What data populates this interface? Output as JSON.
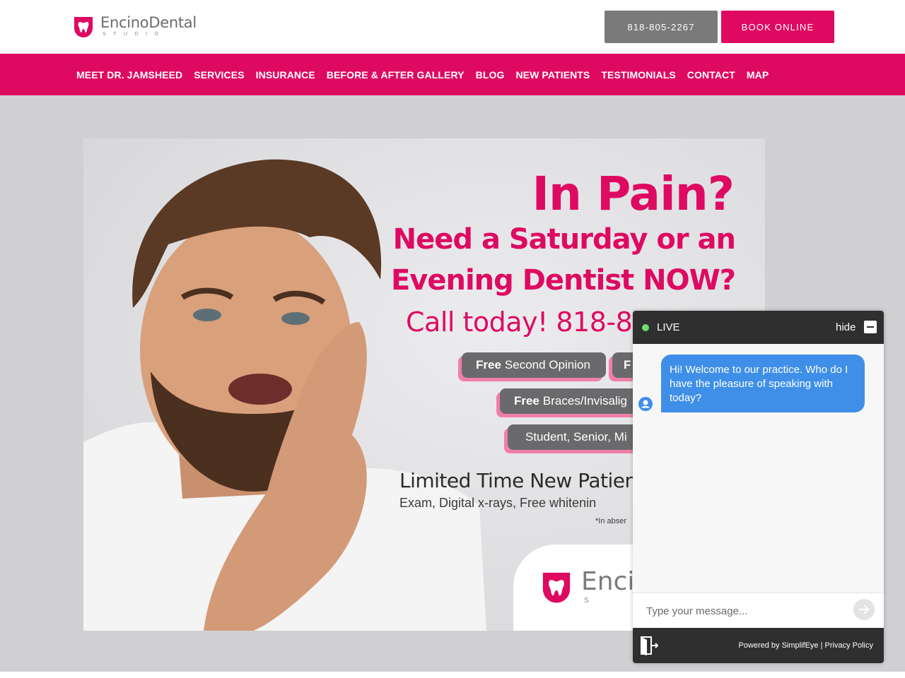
{
  "header": {
    "logo": {
      "name_a": "Encino",
      "name_b": "Dental",
      "sub": "STUDIO"
    },
    "phone_button": "818-805-2267",
    "book_button": "BOOK ONLINE"
  },
  "nav": {
    "items": [
      "MEET DR. JAMSHEED",
      "SERVICES",
      "INSURANCE",
      "BEFORE & AFTER GALLERY",
      "BLOG",
      "NEW PATIENTS",
      "TESTIMONIALS",
      "CONTACT",
      "MAP"
    ]
  },
  "hero": {
    "line1": "In Pain?",
    "line2": "Need a Saturday or an",
    "line3": "Evening Dentist NOW?",
    "line4": "Call today! 818-80",
    "pills": [
      {
        "bold": "Free",
        "rest": "Second Opinion"
      },
      {
        "bold": "F",
        "rest": ""
      },
      {
        "bold": "Free",
        "rest": "Braces/Invisalig"
      },
      {
        "bold": "",
        "rest": "Student, Senior, Mi"
      }
    ],
    "offer_title": "Limited Time New Patien",
    "offer_sub": "Exam, Digital x-rays, Free whitenin",
    "offer_note": "*In abser",
    "card_name": "Encin",
    "card_sub": "S T"
  },
  "chat": {
    "status": "LIVE",
    "hide": "hide",
    "message": "Hi! Welcome to our practice.  Who do I have the pleasure of speaking with today?",
    "input_placeholder": "Type your message...",
    "powered_by": "Powered by SimplifEye",
    "separator": "|",
    "privacy": "Privacy Policy"
  },
  "colors": {
    "brand_pink": "#de0a62",
    "phone_gray": "#7a7a7a",
    "chat_blue": "#3f8fe8",
    "chat_dark": "#2f2f2f"
  }
}
